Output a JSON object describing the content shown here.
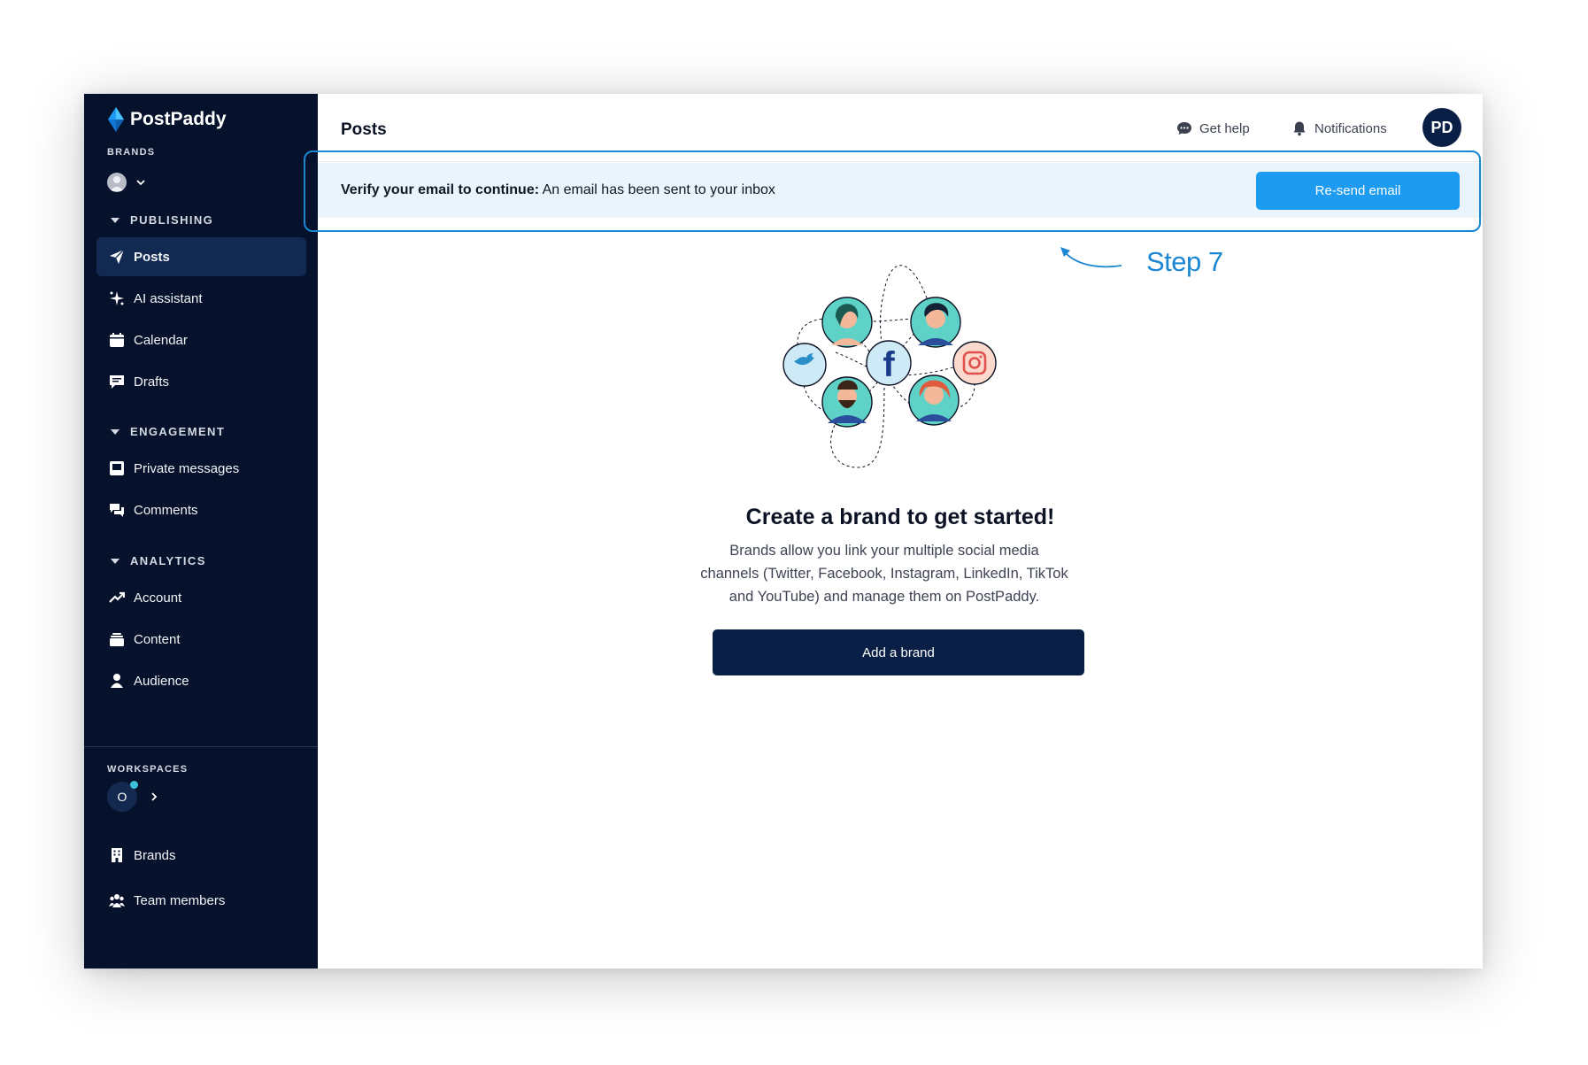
{
  "app": {
    "name": "PostPaddy"
  },
  "sidebar": {
    "brands_label": "BRANDS",
    "groups": [
      {
        "label": "PUBLISHING",
        "items": [
          {
            "label": "Posts",
            "icon": "send-icon",
            "active": true
          },
          {
            "label": "AI assistant",
            "icon": "sparkle-icon"
          },
          {
            "label": "Calendar",
            "icon": "calendar-icon"
          },
          {
            "label": "Drafts",
            "icon": "drafts-icon"
          }
        ]
      },
      {
        "label": "ENGAGEMENT",
        "items": [
          {
            "label": "Private messages",
            "icon": "inbox-icon"
          },
          {
            "label": "Comments",
            "icon": "comments-icon"
          }
        ]
      },
      {
        "label": "ANALYTICS",
        "items": [
          {
            "label": "Account",
            "icon": "trending-up-icon"
          },
          {
            "label": "Content",
            "icon": "layers-icon"
          },
          {
            "label": "Audience",
            "icon": "person-icon"
          }
        ]
      }
    ],
    "workspaces_label": "WORKSPACES",
    "workspace_initial": "O",
    "bottom_items": [
      {
        "label": "Brands",
        "icon": "building-icon"
      },
      {
        "label": "Team members",
        "icon": "team-icon"
      }
    ]
  },
  "header": {
    "title": "Posts",
    "get_help": "Get help",
    "notifications": "Notifications",
    "user_initials": "PD"
  },
  "verify": {
    "bold": "Verify your email to continue:",
    "text": " An email has been sent to your inbox",
    "button": "Re-send email"
  },
  "annotation": {
    "step": "Step 7"
  },
  "empty_state": {
    "title": "Create a brand to get started!",
    "description": "Brands allow you link your multiple social media channels (Twitter, Facebook, Instagram, LinkedIn, TikTok and YouTube) and manage them on PostPaddy.",
    "button": "Add a brand"
  },
  "colors": {
    "sidebar_bg": "#06122b",
    "primary_dark": "#0a1f45",
    "accent_blue": "#1d9bf0",
    "verify_bg": "#e9f4fc",
    "annotation": "#1b86d1"
  }
}
